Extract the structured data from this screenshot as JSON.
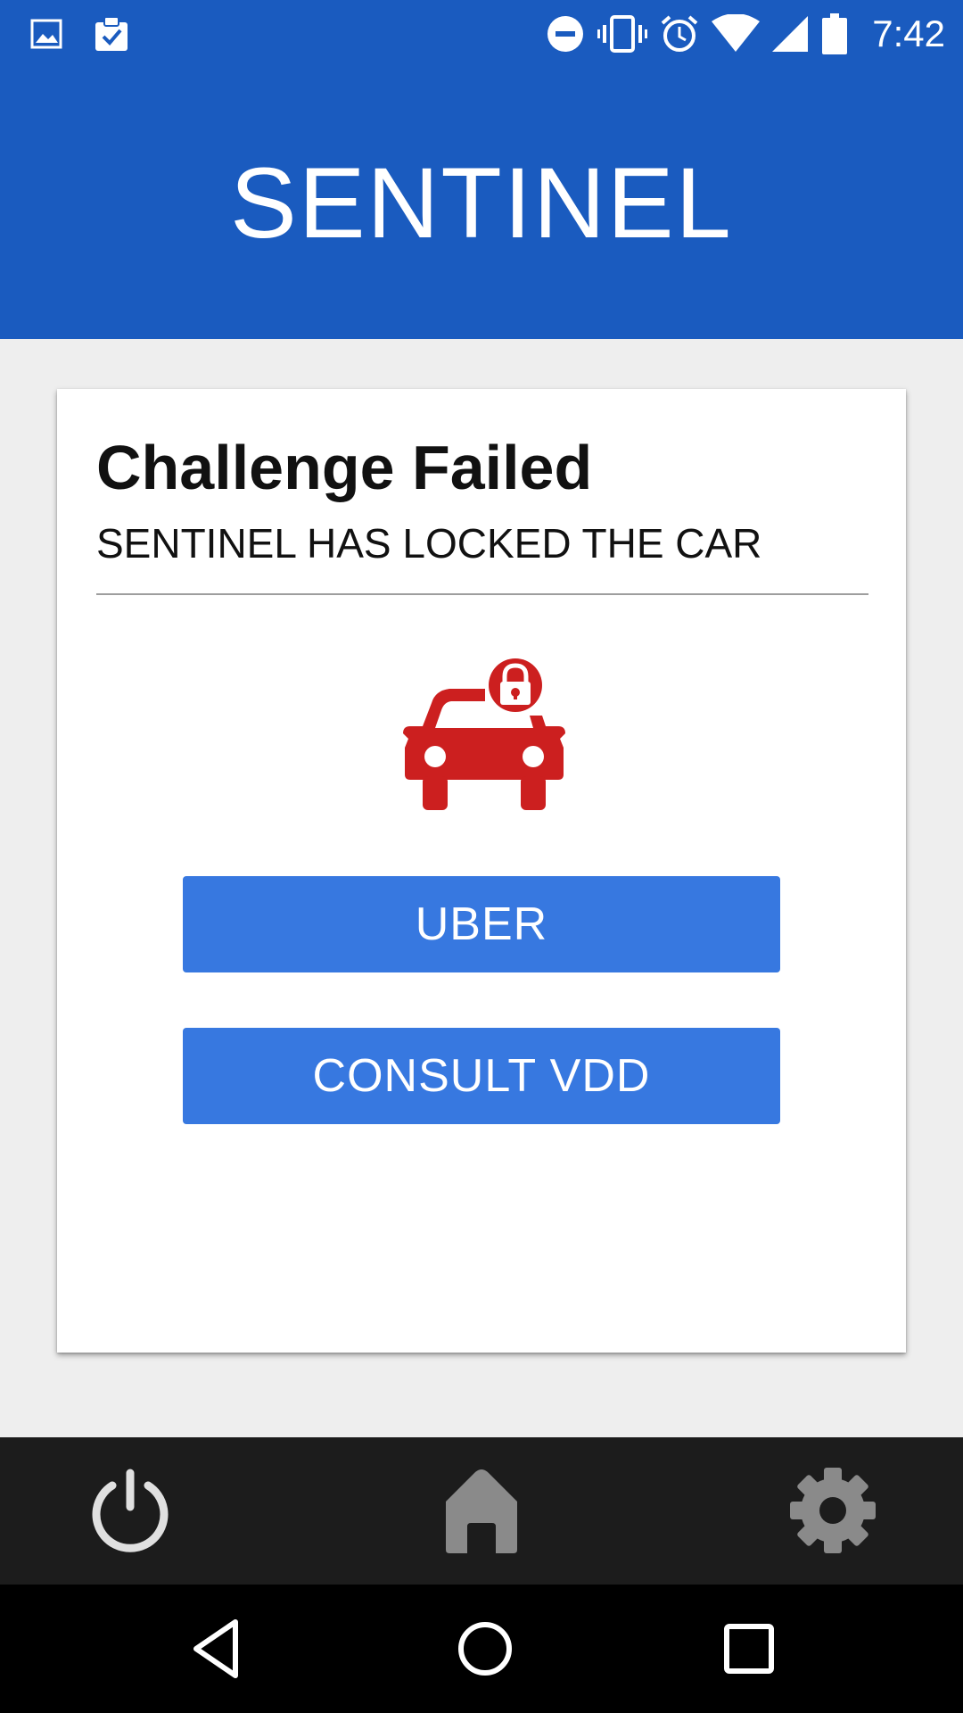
{
  "status_bar": {
    "time": "7:42",
    "icons": [
      "image-icon",
      "clipboard-check-icon",
      "do-not-disturb-icon",
      "vibrate-icon",
      "alarm-icon",
      "wifi-icon",
      "cell-signal-icon",
      "battery-icon"
    ]
  },
  "app_bar": {
    "title": "SENTINEL"
  },
  "card": {
    "title": "Challenge Failed",
    "subtitle": "SENTINEL HAS LOCKED THE CAR",
    "icon": "car-locked-icon",
    "icon_color": "#cc1f1f",
    "buttons": {
      "uber": "UBER",
      "consult": "CONSULT VDD"
    }
  },
  "bottom_nav": {
    "items": [
      "power-icon",
      "home-icon",
      "settings-icon"
    ]
  },
  "system_nav": {
    "items": [
      "back-icon",
      "home-circle-icon",
      "recents-icon"
    ]
  },
  "colors": {
    "primary": "#1a5bbf",
    "button": "#3778e0",
    "background": "#eeeeee",
    "nav_bar": "#1c1c1c"
  }
}
